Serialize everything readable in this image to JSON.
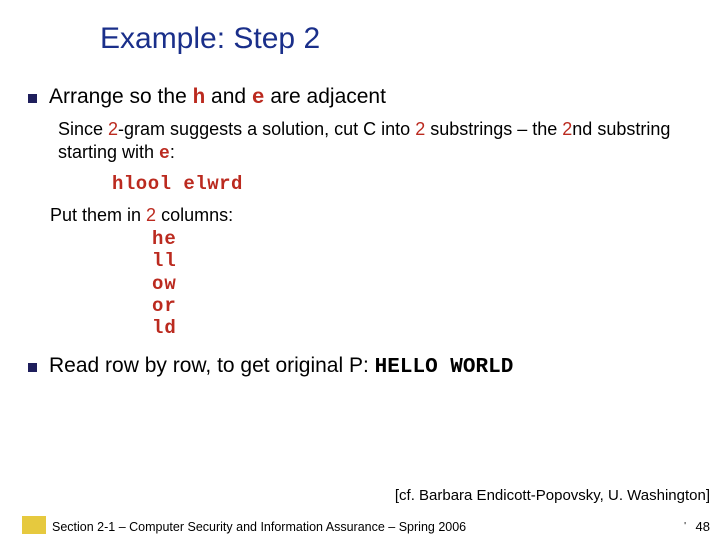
{
  "title": "Example: Step 2",
  "bullet1": {
    "pre": "Arrange so the ",
    "h": "h",
    "mid": " and ",
    "e": "e",
    "post": " are adjacent"
  },
  "sub1": {
    "a": "Since ",
    "n1": "2",
    "b": "-gram suggests a solution, cut C into ",
    "n2": "2",
    "c": " substrings – the ",
    "n3": "2",
    "d": "nd substring starting with ",
    "e": "e",
    "f": ":"
  },
  "code1": "hlool elwrd",
  "sub2": {
    "a": "Put them in ",
    "n": "2",
    "b": " columns:"
  },
  "grid": [
    "he",
    "ll",
    "ow",
    "or",
    "ld"
  ],
  "bullet2": {
    "a": "Read row by row, to get original P: ",
    "code": "HELLO WORLD"
  },
  "citation": "[cf. Barbara Endicott-Popovsky, U. Washington]",
  "footer": "Section 2-1 – Computer Security and Information Assurance – Spring 2006",
  "slidenum": "48",
  "tick": "'"
}
